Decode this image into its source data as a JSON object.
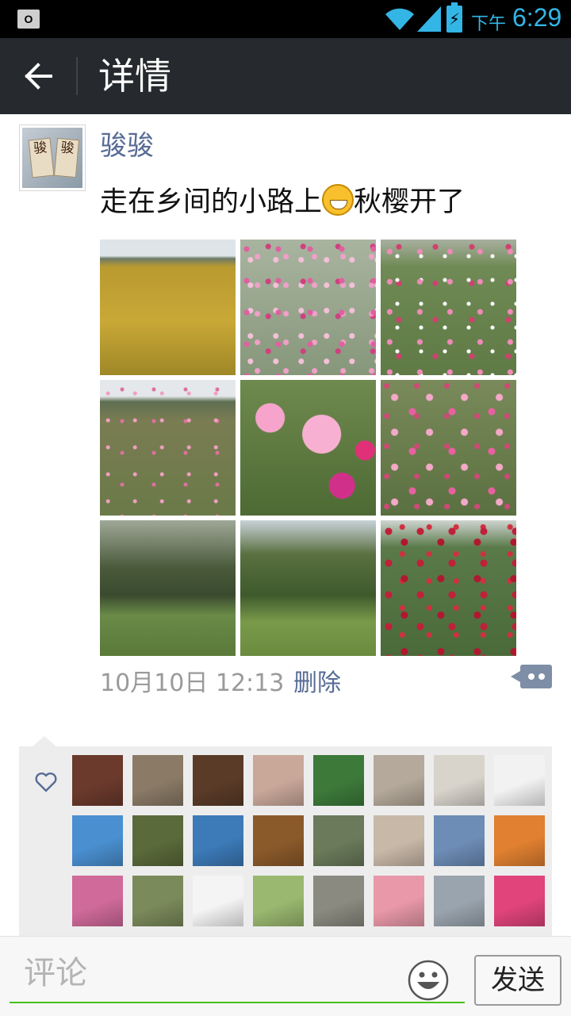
{
  "status_bar": {
    "ampm": "下午",
    "time": "6:29",
    "notification_icon": "outlook-icon",
    "battery_glyph": "⚡"
  },
  "header": {
    "title": "详情",
    "back_icon": "arrow-left-icon"
  },
  "post": {
    "username": "骏骏",
    "avatar_text": [
      "骏",
      "骏"
    ],
    "text_before_emoji": "走在乡间的小路上",
    "emoji": "grinning-face-emoji",
    "text_after_emoji": "秋樱开了",
    "photos": [
      {
        "subject": "rice-field"
      },
      {
        "subject": "cosmos-field"
      },
      {
        "subject": "cosmos-field"
      },
      {
        "subject": "cosmos-field-horizon"
      },
      {
        "subject": "cosmos-closeup"
      },
      {
        "subject": "cosmos-field"
      },
      {
        "subject": "park-trees"
      },
      {
        "subject": "park-trees"
      },
      {
        "subject": "red-flower-bush"
      }
    ],
    "timestamp": "10月10日 12:13",
    "delete_label": "删除"
  },
  "likes": {
    "icon": "heart-icon",
    "avatars": [
      {
        "color": "#6b3a2c"
      },
      {
        "color": "#8a7a66"
      },
      {
        "color": "#5a3b28"
      },
      {
        "color": "#c9a89a"
      },
      {
        "color": "#3d7a3a"
      },
      {
        "color": "#b4a99a"
      },
      {
        "color": "#d8d4cc"
      },
      {
        "color": "#f2f2f2"
      },
      {
        "color": "#4a8fd0"
      },
      {
        "color": "#5a6a3a"
      },
      {
        "color": "#3c7ab8"
      },
      {
        "color": "#8b5a2a"
      },
      {
        "color": "#6a7a5a"
      },
      {
        "color": "#c8b8a8"
      },
      {
        "color": "#6d8cb6"
      },
      {
        "color": "#e08030"
      },
      {
        "color": "#d06a9a"
      },
      {
        "color": "#7a8a5a"
      },
      {
        "color": "#f4f4f4"
      },
      {
        "color": "#9ab870"
      },
      {
        "color": "#8a8a80"
      },
      {
        "color": "#e898a8"
      },
      {
        "color": "#9aa4ae"
      },
      {
        "color": "#e0447a"
      }
    ]
  },
  "comment_bar": {
    "placeholder": "评论",
    "send_label": "发送",
    "emoji_icon": "smiley-icon"
  },
  "colors": {
    "link": "#576b95",
    "titlebar": "#262a2e",
    "accent_green": "#45c01a"
  }
}
